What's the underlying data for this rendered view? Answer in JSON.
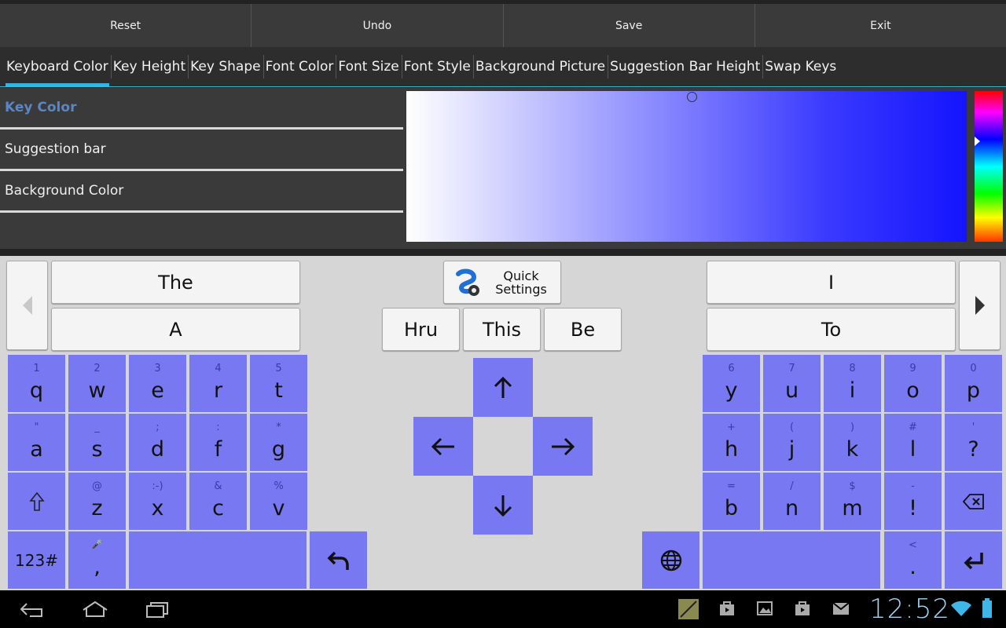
{
  "actionbar": {
    "reset": "Reset",
    "undo": "Undo",
    "save": "Save",
    "exit": "Exit"
  },
  "tabs": [
    {
      "label": "Keyboard Color",
      "active": true
    },
    {
      "label": "Key Height"
    },
    {
      "label": "Key Shape"
    },
    {
      "label": "Font Color"
    },
    {
      "label": "Font Size"
    },
    {
      "label": "Font Style"
    },
    {
      "label": "Background Picture"
    },
    {
      "label": "Suggestion Bar Height"
    },
    {
      "label": "Swap Keys"
    }
  ],
  "color_targets": [
    {
      "label": "Key Color",
      "selected": true
    },
    {
      "label": "Suggestion bar"
    },
    {
      "label": "Background Color"
    }
  ],
  "colors": {
    "key_fill": "#7878f2",
    "accent": "#33b5e5",
    "selected_item": "#5b86c6",
    "picker_hue": "#1414ff"
  },
  "suggestions": {
    "left_top": "The",
    "left_bottom": "A",
    "quick_settings": "Quick\nSettings",
    "mid": [
      "Hru",
      "This",
      "Be"
    ],
    "right_top": "I",
    "right_bottom": "To"
  },
  "keys": {
    "row1_left": [
      {
        "sec": "1",
        "pri": "q"
      },
      {
        "sec": "2",
        "pri": "w"
      },
      {
        "sec": "3",
        "pri": "e"
      },
      {
        "sec": "4",
        "pri": "r"
      },
      {
        "sec": "5",
        "pri": "t"
      }
    ],
    "row2_left": [
      {
        "sec": "\"",
        "pri": "a"
      },
      {
        "sec": "_",
        "pri": "s"
      },
      {
        "sec": ";",
        "pri": "d"
      },
      {
        "sec": ":",
        "pri": "f"
      },
      {
        "sec": "*",
        "pri": "g"
      }
    ],
    "row3_left": [
      {
        "sec": "@",
        "pri": "z"
      },
      {
        "sec": ":-)",
        "pri": "x"
      },
      {
        "sec": "&",
        "pri": "c"
      },
      {
        "sec": "%",
        "pri": "v"
      }
    ],
    "row1_right": [
      {
        "sec": "6",
        "pri": "y"
      },
      {
        "sec": "7",
        "pri": "u"
      },
      {
        "sec": "8",
        "pri": "i"
      },
      {
        "sec": "9",
        "pri": "o"
      },
      {
        "sec": "0",
        "pri": "p"
      }
    ],
    "row2_right": [
      {
        "sec": "+",
        "pri": "h"
      },
      {
        "sec": "(",
        "pri": "j"
      },
      {
        "sec": ")",
        "pri": "k"
      },
      {
        "sec": "#",
        "pri": "l"
      },
      {
        "sec": "'",
        "pri": "?"
      }
    ],
    "row3_right": [
      {
        "sec": "=",
        "pri": "b"
      },
      {
        "sec": "/",
        "pri": "n"
      },
      {
        "sec": "$",
        "pri": "m"
      },
      {
        "sec": "-",
        "pri": "!"
      }
    ],
    "num_label": "123#",
    "comma": {
      "sec": "🎤",
      "pri": ","
    },
    "period": {
      "sec": "<",
      "pri": "."
    }
  },
  "statusbar": {
    "time": "12:52"
  }
}
